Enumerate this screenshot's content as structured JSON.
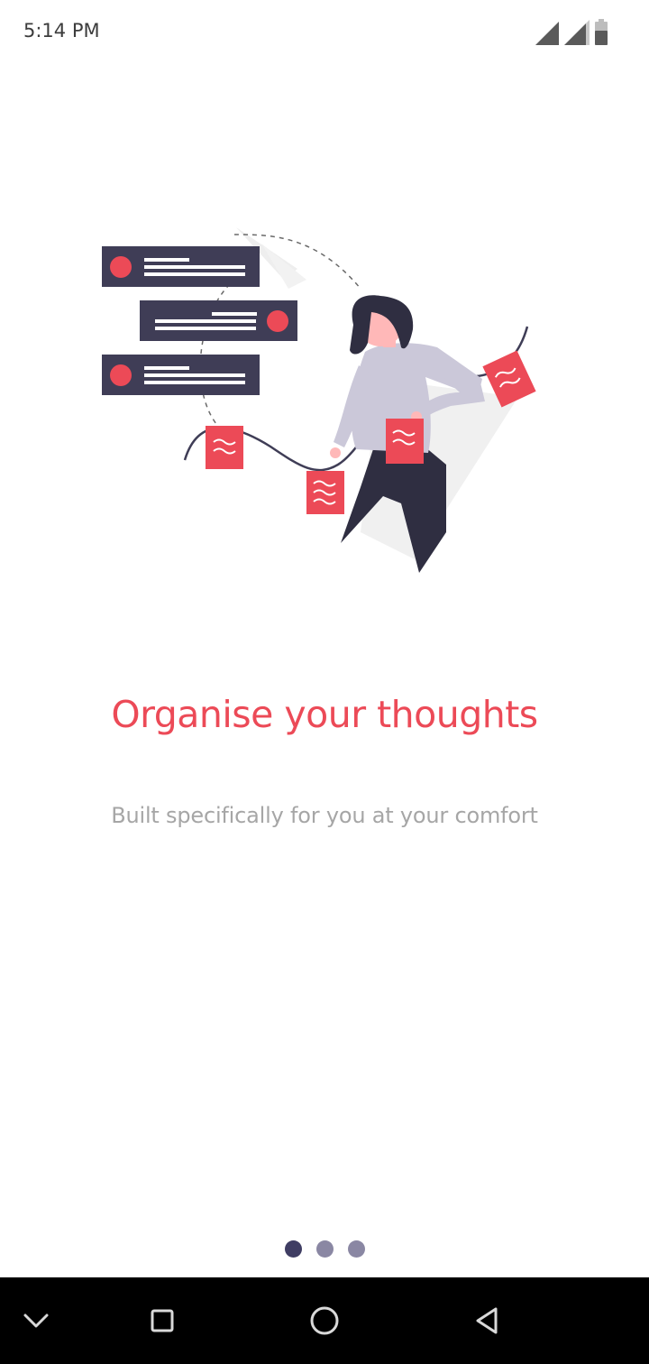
{
  "status_bar": {
    "time": "5:14 PM",
    "icons": [
      "signal-icon",
      "signal-icon",
      "battery-icon"
    ]
  },
  "onboarding": {
    "headline": "Organise your thoughts",
    "subtitle": "Built specifically for you at your comfort",
    "pages_total": 3,
    "current_page": 1
  },
  "nav_bar": {
    "icons": [
      "chevron-down-icon",
      "recents-square-icon",
      "home-circle-icon",
      "back-triangle-icon"
    ]
  },
  "colors": {
    "accent": "#ec4a57",
    "dark": "#3f3d56",
    "dot_active": "#3f3d63",
    "dot_inactive": "#8a87a3",
    "subtitle": "#a6a6a6"
  }
}
